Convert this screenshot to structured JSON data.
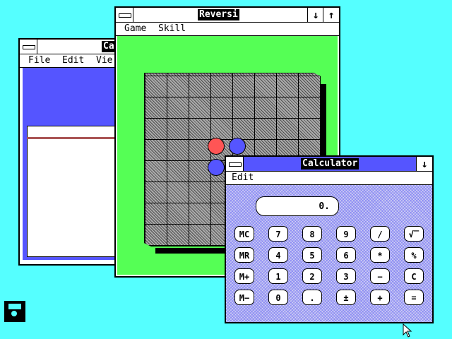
{
  "desktop": {
    "background": "#55ffff",
    "disk_icon": "floppy-disk-icon"
  },
  "calculator_back": {
    "title": "Ca",
    "menu": [
      "File",
      "Edit",
      "Vie"
    ]
  },
  "reversi": {
    "title": "Reversi",
    "menu": [
      "Game",
      "Skill"
    ],
    "minimize_icon": "↓",
    "maximize_icon": "↑"
  },
  "calculator": {
    "title": "Calculator",
    "menu": [
      "Edit"
    ],
    "minimize_icon": "↓",
    "display": "0.",
    "keys": [
      [
        "MC",
        "7",
        "8",
        "9",
        "/",
        "√‾"
      ],
      [
        "MR",
        "4",
        "5",
        "6",
        "*",
        "%"
      ],
      [
        "M+",
        "1",
        "2",
        "3",
        "−",
        "C"
      ],
      [
        "M−",
        "0",
        ".",
        "±",
        "+",
        "="
      ]
    ]
  },
  "colors": {
    "active_title": "#5555ff",
    "board_green": "#55ff55",
    "red_disc": "#ff5555",
    "blue_disc": "#5555ff"
  }
}
